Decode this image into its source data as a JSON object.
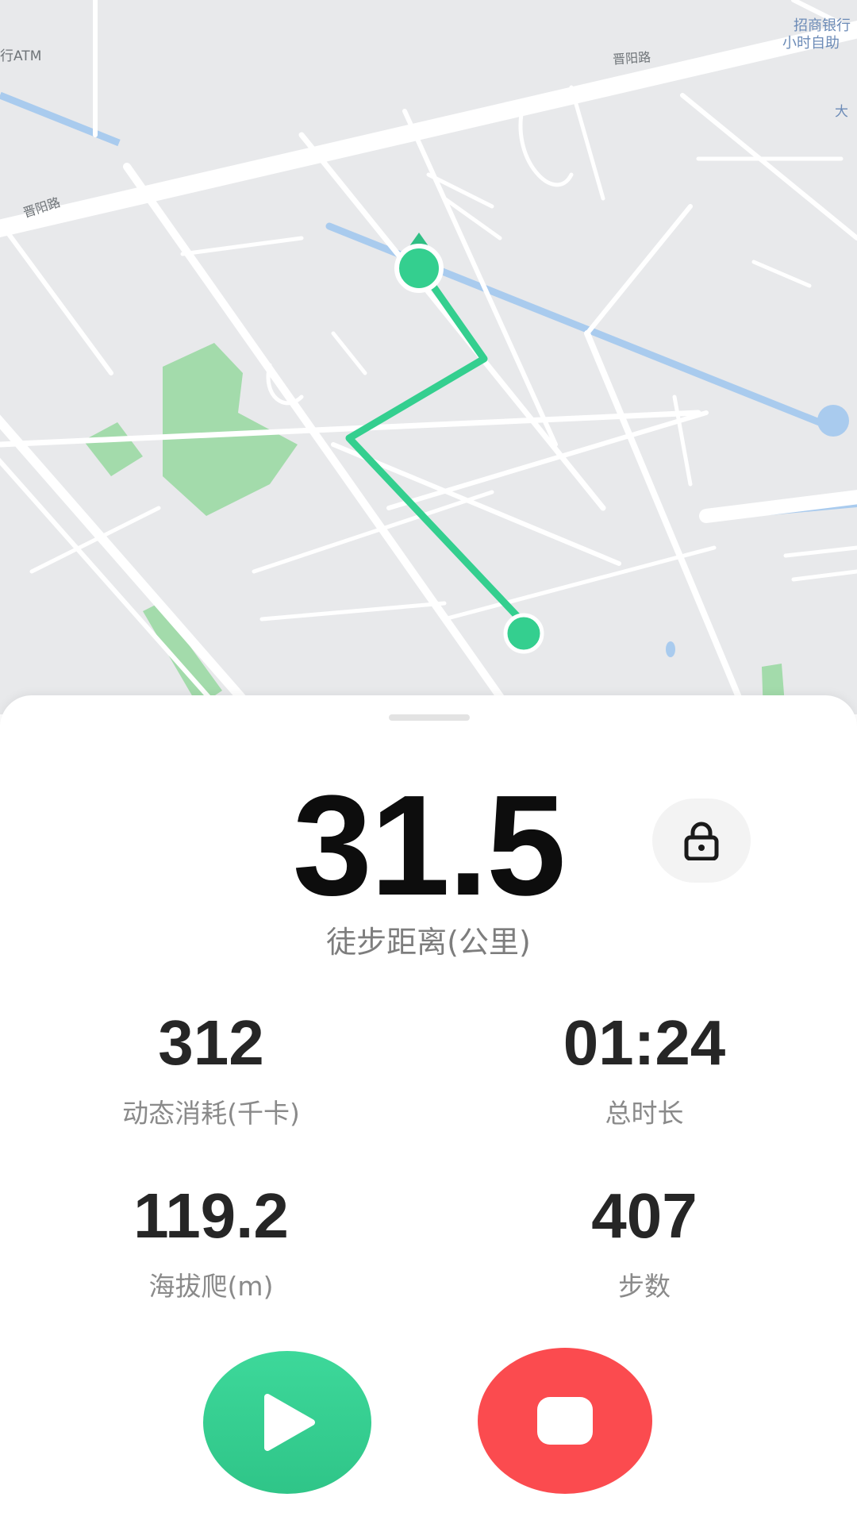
{
  "map": {
    "poi_atm": "行ATM",
    "road_jinyang_top": "晋阳路",
    "road_jinyang_left": "晋阳路",
    "bank_line1": "招商银行",
    "bank_line2": "小时自助",
    "label_da": "大",
    "colors": {
      "route": "#34cf8f",
      "water": "#a9cbee",
      "park": "#a3dbab",
      "road": "#ffffff",
      "ground": "#e8e9eb"
    },
    "icons": [
      "route-start-marker-icon",
      "route-end-marker-icon",
      "direction-arrow-icon"
    ]
  },
  "summary": {
    "distance": "31.5",
    "distance_label": "徒步距离(公里)",
    "lock_icon": "lock-icon"
  },
  "stats": {
    "calories_value": "312",
    "calories_label": "动态消耗(千卡)",
    "duration_value": "01:24",
    "duration_label": "总时长",
    "elevation_value": "119.2",
    "elevation_label": "海拔爬(m)",
    "steps_value": "407",
    "steps_label": "步数"
  },
  "controls": {
    "play_icon": "play-icon",
    "stop_icon": "stop-icon",
    "colors": {
      "play": "#34cf8f",
      "stop": "#fb4b4f"
    }
  }
}
